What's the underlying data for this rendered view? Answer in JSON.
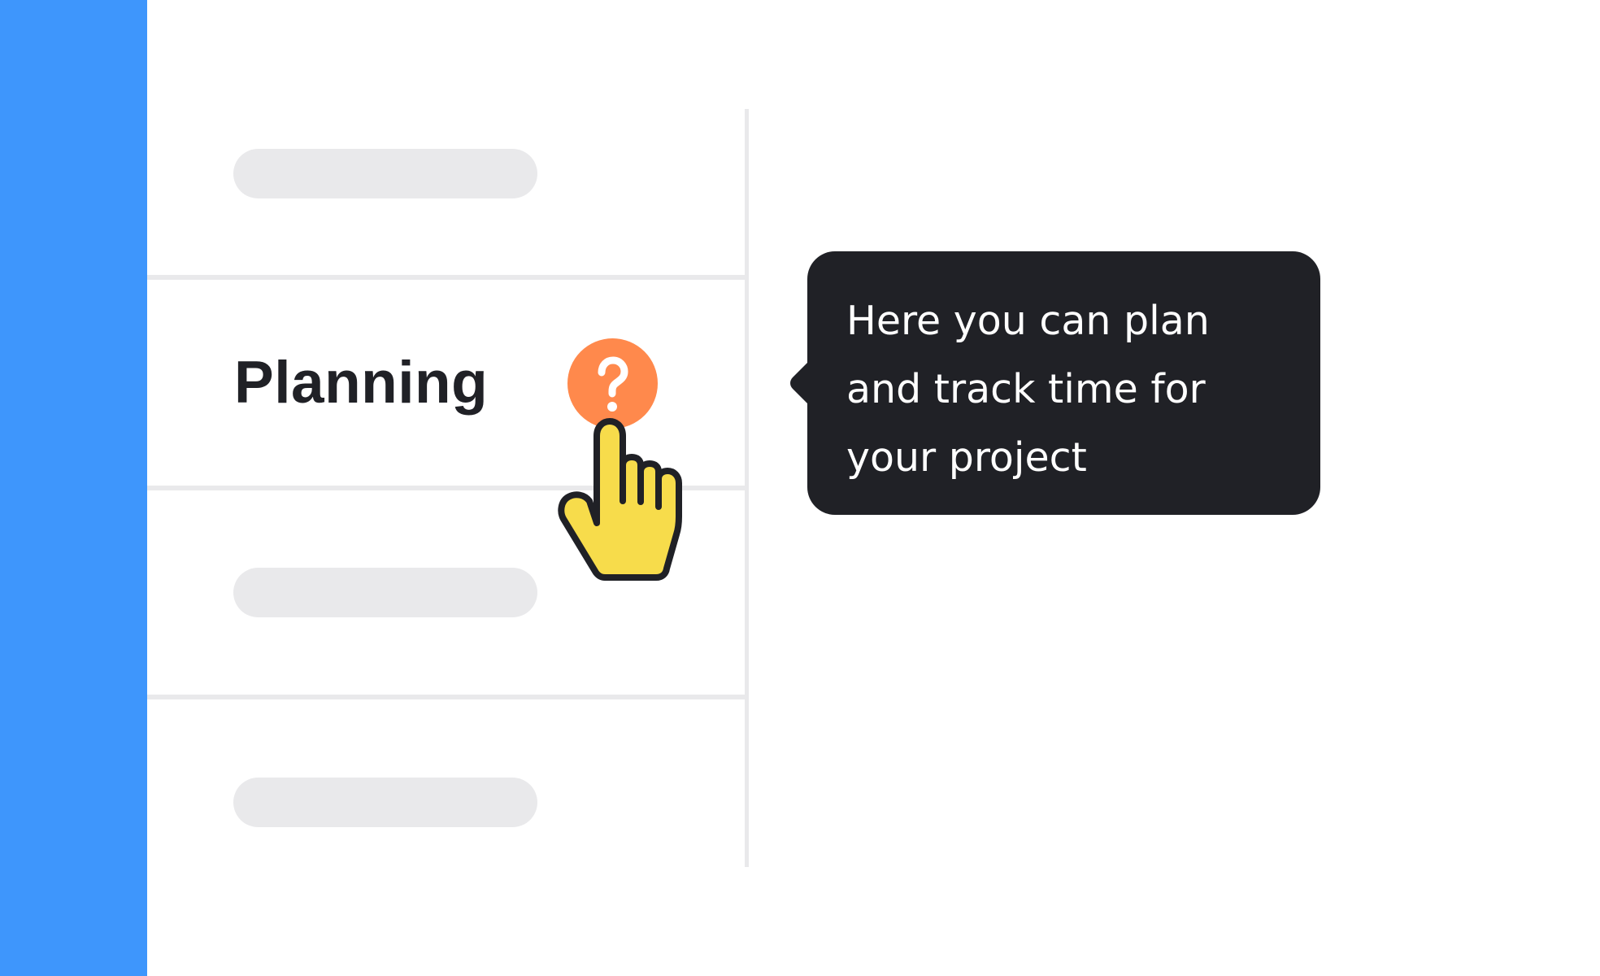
{
  "menu": {
    "active_item": {
      "label": "Planning",
      "help_icon": "question-mark-icon"
    },
    "placeholder_items": 3
  },
  "tooltip": {
    "text": "Here you can plan and track time for your project"
  },
  "cursor": {
    "icon": "pointing-hand-icon"
  },
  "colors": {
    "sidebar": "#3e96fc",
    "help_button": "#ff894c",
    "tooltip_background": "#202126",
    "tooltip_text": "#ffffff",
    "label_text": "#202126",
    "placeholder": "#e9e9eb",
    "divider": "#e9e9eb",
    "hand_fill": "#f7dc4b"
  }
}
